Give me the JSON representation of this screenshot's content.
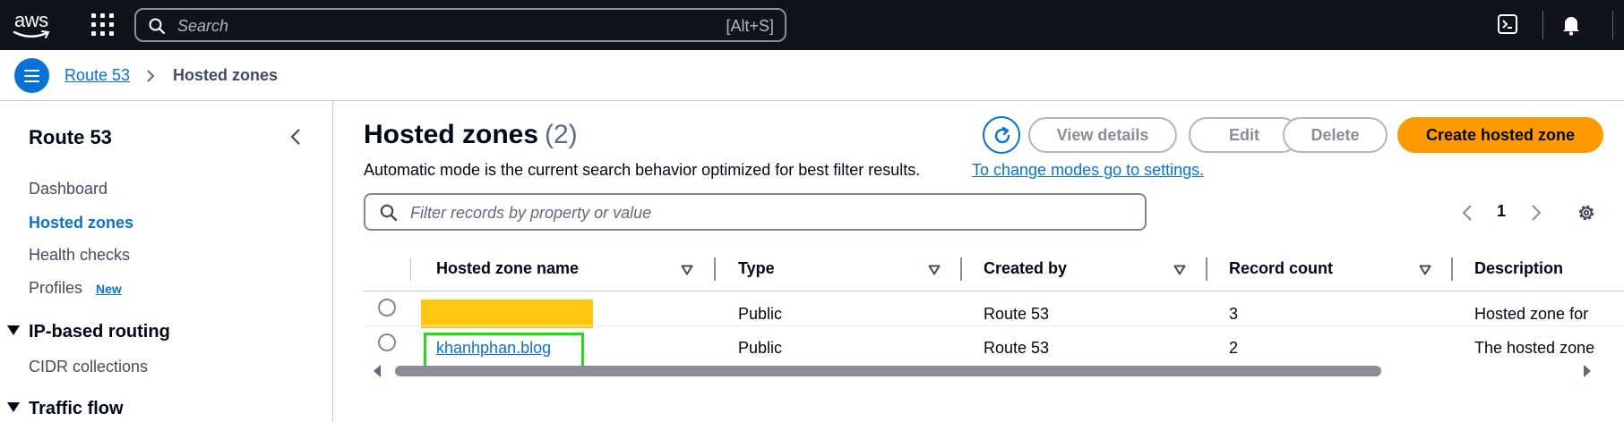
{
  "topnav": {
    "logo_text": "aws",
    "search_placeholder": "Search",
    "search_shortcut": "[Alt+S]"
  },
  "breadcrumb": {
    "service": "Route 53",
    "current": "Hosted zones"
  },
  "sidebar": {
    "title": "Route 53",
    "items": [
      {
        "label": "Dashboard",
        "active": false
      },
      {
        "label": "Hosted zones",
        "active": true
      },
      {
        "label": "Health checks",
        "active": false
      },
      {
        "label": "Profiles",
        "active": false,
        "badge": "New"
      }
    ],
    "sections": [
      {
        "label": "IP-based routing",
        "items": [
          "CIDR collections"
        ]
      },
      {
        "label": "Traffic flow",
        "items": []
      }
    ]
  },
  "main": {
    "title": "Hosted zones",
    "count": "(2)",
    "buttons": {
      "view_details": "View details",
      "edit": "Edit",
      "delete": "Delete",
      "create": "Create hosted zone"
    },
    "description": "Automatic mode is the current search behavior optimized for best filter results.",
    "description_link": "To change modes go to settings.",
    "filter_placeholder": "Filter records by property or value",
    "pagination": {
      "current_page": "1"
    }
  },
  "table": {
    "columns": [
      "Hosted zone name",
      "Type",
      "Created by",
      "Record count",
      "Description"
    ],
    "rows": [
      {
        "name": "",
        "redacted": true,
        "type": "Public",
        "created_by": "Route 53",
        "record_count": "3",
        "description": "Hosted zone for"
      },
      {
        "name": "khanhphan.blog",
        "redacted": false,
        "type": "Public",
        "created_by": "Route 53",
        "record_count": "2",
        "description": "The hosted zone"
      }
    ]
  },
  "colors": {
    "nav_bg": "#0f141a",
    "link": "#0972d3",
    "primary": "#ff9900",
    "redaction": "#ffc70e",
    "highlight": "#22dd11"
  }
}
